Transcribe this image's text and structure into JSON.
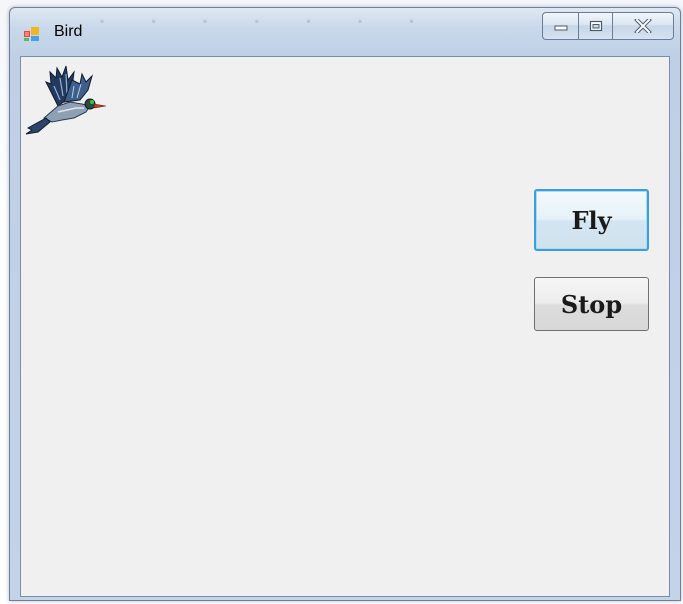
{
  "window": {
    "title": "Bird"
  },
  "controls": {
    "fly_label": "Fly",
    "stop_label": "Stop"
  },
  "icons": {
    "app": "app-icon",
    "minimize": "minimize-icon",
    "maximize": "maximize-icon",
    "close": "close-icon",
    "bird": "bird-image"
  },
  "colors": {
    "client_background": "#f0f0f0",
    "focus_border": "#3c9fd8",
    "title_bar": "#c9d8ea"
  }
}
